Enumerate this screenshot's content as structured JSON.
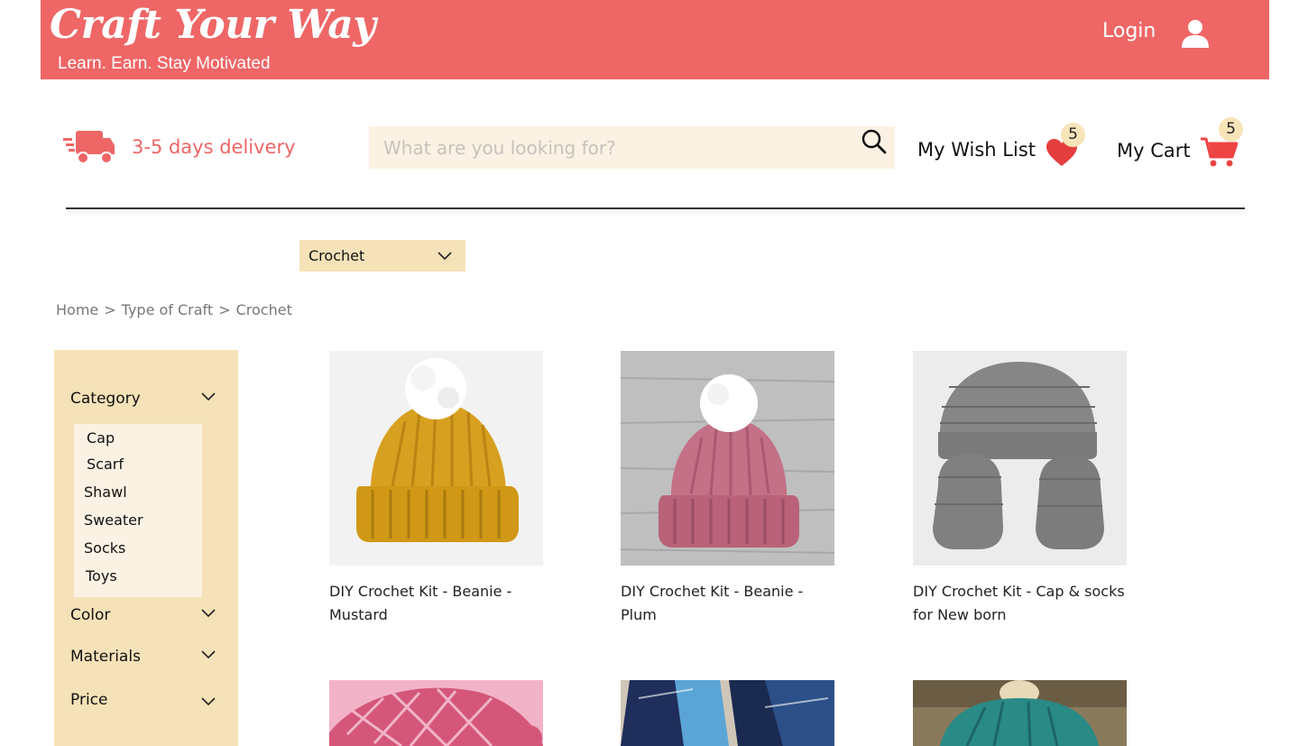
{
  "header": {
    "brand_title": "Craft Your Way",
    "brand_tagline": "Learn. Earn. Stay Motivated",
    "login_label": "Login",
    "background": "#ef6666"
  },
  "delivery": {
    "text": "3-5 days delivery",
    "icon": "truck-icon"
  },
  "search": {
    "placeholder": "What are you looking for?",
    "value": ""
  },
  "wishlist": {
    "label": "My Wish List",
    "count": "5",
    "icon": "heart-icon"
  },
  "cart": {
    "label": "My Cart",
    "count": "5",
    "icon": "cart-icon"
  },
  "category_select": {
    "selected": "Crochet"
  },
  "breadcrumb": {
    "items": [
      "Home",
      "Type of Craft",
      "Crochet"
    ],
    "separator": ">"
  },
  "filters": {
    "category": {
      "label": "Category",
      "items": [
        "Cap",
        "Scarf",
        "Shawl",
        "Sweater",
        "Socks",
        "Toys"
      ]
    },
    "color": {
      "label": "Color"
    },
    "materials": {
      "label": "Materials"
    },
    "price": {
      "label": "Price"
    }
  },
  "products": [
    {
      "title": "DIY Crochet Kit - Beanie - Mustard",
      "image": "mustard-beanie"
    },
    {
      "title": "DIY Crochet Kit - Beanie - Plum",
      "image": "plum-beanie"
    },
    {
      "title": "DIY Crochet Kit - Cap & socks for New born",
      "image": "grey-cap-and-booties"
    }
  ],
  "more_products": [
    {
      "image": "pink-crochet-hat"
    },
    {
      "image": "blue-crochet-scarf"
    },
    {
      "image": "teal-crochet-cowl"
    }
  ],
  "colors": {
    "accent": "#ef6666",
    "panel": "#f5e2b8",
    "light_panel": "#fbf2e3",
    "badge": "#f7e4b8"
  }
}
